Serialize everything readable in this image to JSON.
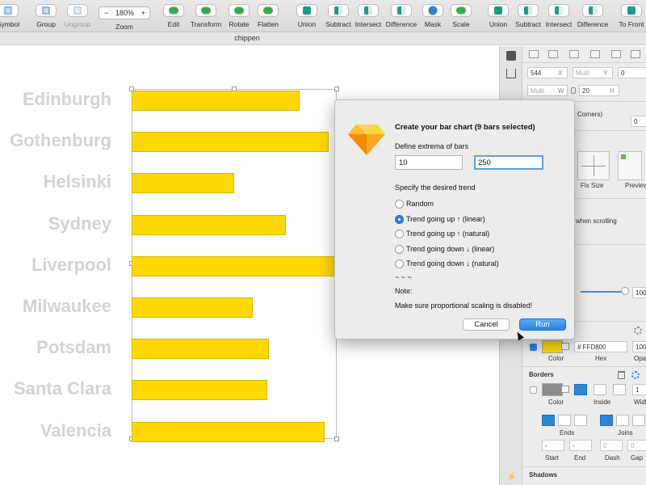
{
  "toolbar": {
    "items": [
      {
        "label": "Symbol",
        "icon": "symbol-icon",
        "enabled": true
      },
      {
        "label": "Group",
        "icon": "group-icon",
        "enabled": true
      },
      {
        "label": "Ungroup",
        "icon": "ungroup-icon",
        "enabled": false
      },
      {
        "label": "Edit",
        "icon": "edit-icon",
        "enabled": true
      },
      {
        "label": "Transform",
        "icon": "transform-icon",
        "enabled": true
      },
      {
        "label": "Rotate",
        "icon": "rotate-icon",
        "enabled": true
      },
      {
        "label": "Flatten",
        "icon": "flatten-icon",
        "enabled": true
      },
      {
        "label": "Union",
        "icon": "union-icon",
        "enabled": true
      },
      {
        "label": "Subtract",
        "icon": "subtract-icon",
        "enabled": true
      },
      {
        "label": "Intersect",
        "icon": "intersect-icon",
        "enabled": true
      },
      {
        "label": "Difference",
        "icon": "difference-icon",
        "enabled": true
      },
      {
        "label": "Mask",
        "icon": "mask-icon",
        "enabled": true
      },
      {
        "label": "Scale",
        "icon": "scale-icon",
        "enabled": true
      },
      {
        "label": "Union",
        "icon": "union-icon",
        "enabled": true
      },
      {
        "label": "Subtract",
        "icon": "subtract-icon",
        "enabled": true
      },
      {
        "label": "Intersect",
        "icon": "intersect-icon",
        "enabled": true
      },
      {
        "label": "Difference",
        "icon": "difference-icon",
        "enabled": true
      },
      {
        "label": "To Front",
        "icon": "to-front-icon",
        "enabled": true
      }
    ],
    "zoom": {
      "minus": "−",
      "value": "180%",
      "plus": "+",
      "label": "Zoom"
    }
  },
  "document": {
    "title": "chippen"
  },
  "canvas": {
    "bar_color": "#FFD800",
    "rows": [
      {
        "city": "Edinburgh",
        "value": 0.82
      },
      {
        "city": "Gothenburg",
        "value": 0.96
      },
      {
        "city": "Helsinki",
        "value": 0.5
      },
      {
        "city": "Sydney",
        "value": 0.75
      },
      {
        "city": "Liverpool",
        "value": 1.0
      },
      {
        "city": "Milwaukee",
        "value": 0.59
      },
      {
        "city": "Potsdam",
        "value": 0.67
      },
      {
        "city": "Santa Clara",
        "value": 0.66
      },
      {
        "city": "Valencia",
        "value": 0.94
      }
    ]
  },
  "inspector": {
    "x_value": "544",
    "x_label": "X",
    "y_placeholder": "Multi",
    "y_label": "Y",
    "rotation_value": "0",
    "w_placeholder": "Multi",
    "w_label": "W",
    "h_value": "20",
    "h_label": "H",
    "corners_text": "Corners)",
    "corners_value": "0",
    "fix_size_label": "Fix Size",
    "preview_label": "Preview",
    "scrolling_text": "when scrolling",
    "opacity_value": "100",
    "fill": {
      "hex": "# FFD800",
      "color_label": "Color",
      "hex_label": "Hex",
      "opacity_value": "100",
      "opacity_label": "Opac"
    },
    "borders": {
      "title": "Borders",
      "color_label": "Color",
      "inside_label": "Inside",
      "width_label": "Widt",
      "width_value": "1",
      "ends_label": "Ends",
      "joins_label": "Joins",
      "start_value": "-",
      "end_value": "-",
      "dash_placeholder": "0",
      "gap_placeholder": "0",
      "start_label": "Start",
      "end_label": "End",
      "dash_label": "Dash",
      "gap_label": "Gap"
    },
    "shadows_title": "Shadows"
  },
  "dialog": {
    "title": "Create your bar chart (9 bars selected)",
    "extrema_label": "Define extrema of bars",
    "min_value": "10",
    "max_value": "250",
    "trend_label": "Specify the desired trend",
    "options": [
      {
        "label": "Random",
        "selected": false
      },
      {
        "label": "Trend going up ↑ (linear)",
        "selected": true
      },
      {
        "label": "Trend going up ↑ (natural)",
        "selected": false
      },
      {
        "label": "Trend going down ↓ (linear)",
        "selected": false
      },
      {
        "label": "Trend going down ↓ (natural)",
        "selected": false
      }
    ],
    "separator": "~ ~ ~",
    "note_label": "Note:",
    "note_text": "Make sure proportional scaling is disabled!",
    "cancel_label": "Cancel",
    "run_label": "Run"
  }
}
